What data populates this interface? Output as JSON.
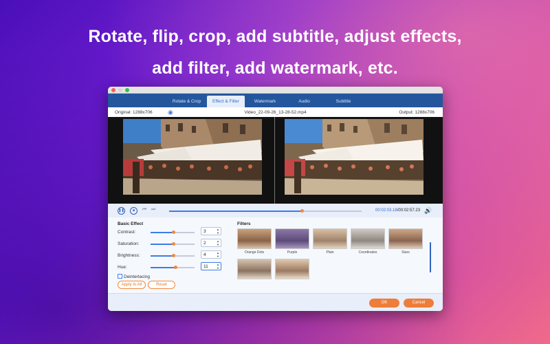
{
  "headline": {
    "line1": "Rotate, flip, crop, add subtitle, adjust effects,",
    "line2": "add filter, add watermark, etc."
  },
  "tabs": [
    {
      "label": "Rotate & Crop",
      "active": false
    },
    {
      "label": "Effect & Filter",
      "active": true
    },
    {
      "label": "Watermark",
      "active": false
    },
    {
      "label": "Audio",
      "active": false
    },
    {
      "label": "Subtitle",
      "active": false
    }
  ],
  "preview": {
    "original": "Original: 1288x706",
    "filename": "Video_22-09-26_13-28-52.mp4",
    "output": "Output: 1288x706"
  },
  "player": {
    "current_time": "00:02:03.18",
    "total_time": "/00:02:57.23",
    "progress": 0.69
  },
  "basic_effect": {
    "title": "Basic Effect",
    "contrast": {
      "label": "Contrast:",
      "value": "3",
      "level": 0.52
    },
    "saturation": {
      "label": "Saturation:",
      "value": "2",
      "level": 0.52
    },
    "brightness": {
      "label": "Brightness:",
      "value": "4",
      "level": 0.52
    },
    "hue": {
      "label": "Hue:",
      "value": "11",
      "level": 0.56
    },
    "deinterlacing": "Deinterlacing",
    "apply_all": "Apply to All",
    "reset": "Reset"
  },
  "filters": {
    "title": "Filters",
    "items": [
      "Orange Dots",
      "Purple",
      "Plain",
      "Coordinates",
      "Stars",
      "",
      ""
    ]
  },
  "footer": {
    "ok": "OK",
    "cancel": "Cancel"
  },
  "colors": {
    "accent": "#ee7d3a",
    "tabbar": "#24569e",
    "progress": "#3c7be6"
  }
}
